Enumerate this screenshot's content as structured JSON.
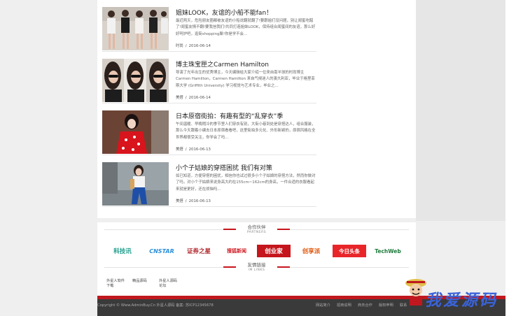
{
  "articles": [
    {
      "title": "姐妹LOOK，友谊的小船不能fan！",
      "summary": "最近两天，危险朋友圈都被友谊的小船说翻就翻了!要跟姐们没问题，别让闺蜜吃醋了!闺蜜友情不翻!要我信我们!共同打造姐妹LOOK，保持组合闺蜜间的友谊，那么好好呵护吧，逛街shopping聚!你是学不会...",
      "category": "时尚",
      "date": "2016-06-14"
    },
    {
      "title": "博主珠宝匣之Carmen Hamilton",
      "summary": "导演了光年出生的优秀博主，今天编辑给大家介绍一位来自南半球的时尚博主Carmen Hamilton，Carmen Hamilton 来自气候迷人的澳大利亚，毕业于格里菲斯大学 (Griffith University) 学习视觉与艺术专业，毕业之...",
      "category": "美搭",
      "date": "2016-06-14"
    },
    {
      "title": "日本原宿街拍：有趣有型的“乱穿衣”季",
      "summary": "午间温暖、早晚稍冷的季节里人们穿衣有别，大街小巷到处是穿搭达人，组合服装，那么今天跟着小编去日本原宿看看吧，这里街拍多元化、外形新颖的，原宿风格在全世界都很受关注，你学会了吗...",
      "category": "美搭",
      "date": "2016-06-13"
    },
    {
      "title": "小个子姑娘的穿搭困扰 我们有对策",
      "summary": "如已知道，方便穿搭的困扰，相信你也试过很多小个子姑娘的穿搭方法，然而你做对了吗，对小个子姑娘来说身高大约在155cm~162cm的身高，一件合适的衣服看起来就是更好，还在烦恼吗...",
      "category": "美搭",
      "date": "2016-06-13"
    }
  ],
  "partners": {
    "title": "合作伙伴",
    "subtitle": "PARTNERS",
    "logos": [
      {
        "name": "科技讯",
        "color": "#1a9c8a"
      },
      {
        "name": "CNSTAR",
        "color": "#2a8fd9"
      },
      {
        "name": "证券之星",
        "color": "#b0262a"
      },
      {
        "name": "搜狐新闻",
        "color": "#d01e27"
      },
      {
        "name": "创业家",
        "color": "#ffffff",
        "bg": "#c4161c"
      },
      {
        "name": "创享派",
        "color": "#e05a12"
      },
      {
        "name": "今日头条",
        "color": "#ffffff",
        "bg": "#e8262a"
      },
      {
        "name": "TechWeb",
        "color": "#1e7a3a"
      }
    ]
  },
  "friend_links": {
    "title": "友情链接",
    "subtitle": "IM LINKS",
    "items": [
      "外星人软件",
      "精品源码",
      "外星人源码",
      "下载",
      "论坛"
    ]
  },
  "footer": {
    "copyright": "Copyright © Www.AdminBuy.Cn 外星人源码 备案: 苏ICP12345678",
    "nav": [
      "网站简介",
      "招商说明",
      "商务合作",
      "版权申明",
      "联系"
    ]
  },
  "watermark": "我爱源码",
  "colors": {
    "accent": "#c7161d",
    "footer": "#3a3a3a"
  }
}
